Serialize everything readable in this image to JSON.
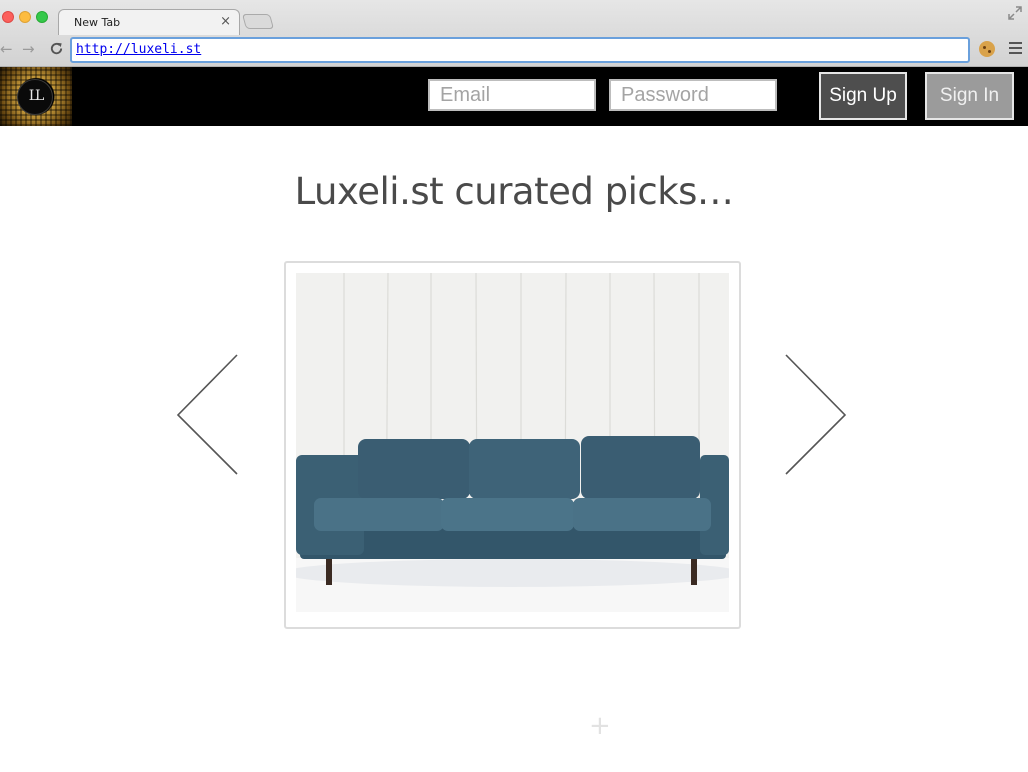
{
  "browser": {
    "tab_title": "New Tab",
    "tab_close": "×",
    "url": "http://luxeli.st",
    "back": "←",
    "forward": "→",
    "reload": "C"
  },
  "header": {
    "logo_text": "LL",
    "email_placeholder": "Email",
    "password_placeholder": "Password",
    "signup_label": "Sign Up",
    "signin_label": "Sign In"
  },
  "main": {
    "headline": "Luxeli.st curated picks…",
    "featured_item": {
      "image": "blue-velvet-sofa"
    },
    "add_label": "+"
  },
  "colors": {
    "header_bg": "#000000",
    "signup_bg": "#4e4e4e",
    "signin_bg": "#9b9b9b",
    "headline": "#4a4a4a",
    "omnibox_focus": "#6aa0dc",
    "sofa": "#3f6478"
  }
}
